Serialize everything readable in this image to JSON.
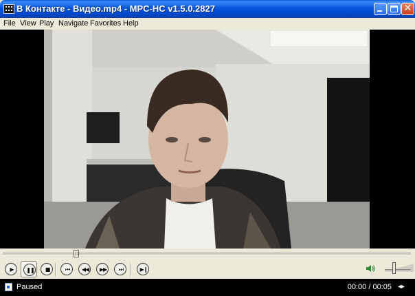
{
  "window": {
    "title": "В Контакте - Видео.mp4 - MPC-HC v1.5.0.2827",
    "title_bar_color": "#0a5fd8",
    "buttons": [
      "minimize",
      "maximize",
      "close"
    ]
  },
  "menu": {
    "items": [
      "File",
      "View",
      "Play",
      "Navigate",
      "Favorites",
      "Help"
    ]
  },
  "video": {
    "description_icon": "video-frame"
  },
  "seek": {
    "position_fraction": 0.18
  },
  "controls": {
    "buttons": [
      {
        "name": "play-button",
        "icon": "▶"
      },
      {
        "name": "pause-button",
        "icon": "❚❚",
        "active": true
      },
      {
        "name": "stop-button",
        "icon": "■"
      },
      {
        "name": "prev-button",
        "icon": "⏮"
      },
      {
        "name": "rewind-button",
        "icon": "◀◀"
      },
      {
        "name": "forward-button",
        "icon": "▶▶"
      },
      {
        "name": "next-button",
        "icon": "⏭"
      },
      {
        "name": "frame-step-button",
        "icon": "▶❙"
      }
    ],
    "volume_level": 0.35
  },
  "status": {
    "state": "Paused",
    "time": "00:00 / 00:05"
  }
}
